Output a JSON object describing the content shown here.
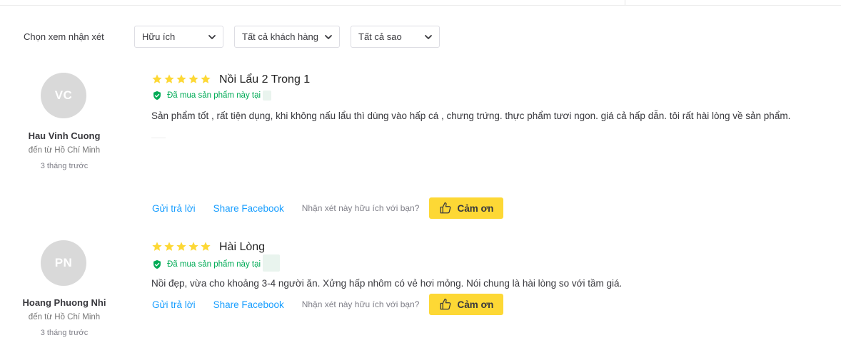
{
  "filters": {
    "label": "Chọn xem nhận xét",
    "sort": "Hữu ích",
    "customers": "Tất cả khách hàng",
    "stars": "Tất cả sao"
  },
  "colors": {
    "star": "#fdd835",
    "verified": "#00ab56",
    "link": "#189eff",
    "thanks_button": "#fdd835",
    "avatar_bg": "#d9d9d9"
  },
  "icons": {
    "chevron": "chevron-down-icon",
    "star": "star-icon",
    "verified": "shield-check-icon",
    "thanks": "thumbs-up-icon"
  },
  "reviews": [
    {
      "initials": "VC",
      "name": "Hau Vinh Cuong",
      "from": "đến từ Hồ Chí Minh",
      "time": "3 tháng trước",
      "rating": 5,
      "title": "Nồi Lẩu 2 Trong 1",
      "verified_text": "Đã mua sản phẩm này tại",
      "content": "Sản phẩm tốt , rất tiện dụng, khi không nấu lẩu thì dùng vào hấp cá , chưng trứng. thực phẩm tươi ngon. giá cả hấp dẫn. tôi rất hài lòng về sản phẩm.",
      "reply": "Gửi trả lời",
      "share": "Share Facebook",
      "helpful_question": "Nhận xét này hữu ích với bạn?",
      "thanks": "Cảm ơn"
    },
    {
      "initials": "PN",
      "name": "Hoang Phuong Nhi",
      "from": "đến từ Hồ Chí Minh",
      "time": "3 tháng trước",
      "rating": 5,
      "title": "Hài Lòng",
      "verified_text": "Đã mua sản phẩm này tại",
      "content": "Nồi đẹp, vừa cho khoảng 3-4 người ăn. Xửng hấp nhôm có vẻ hơi mỏng. Nói chung là hài lòng so với tầm giá.",
      "reply": "Gửi trả lời",
      "share": "Share Facebook",
      "helpful_question": "Nhận xét này hữu ích với bạn?",
      "thanks": "Cảm ơn"
    }
  ]
}
